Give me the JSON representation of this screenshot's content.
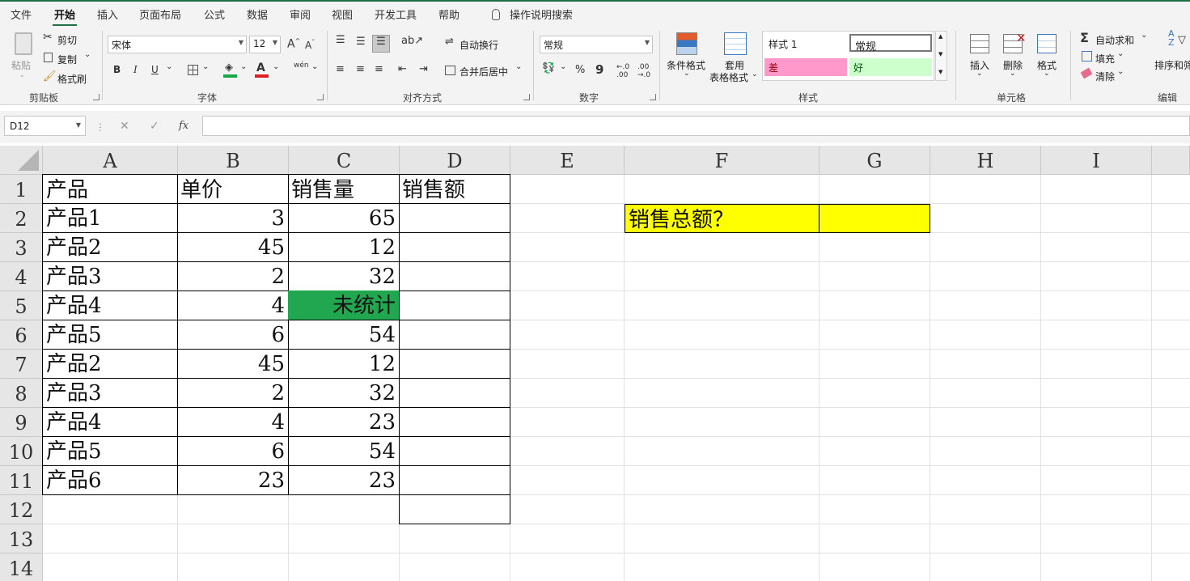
{
  "ribbon_tabs": [
    "文件",
    "开始",
    "插入",
    "页面布局",
    "公式",
    "数据",
    "审阅",
    "视图",
    "开发工具",
    "帮助"
  ],
  "tell_me": "操作说明搜索",
  "clipboard": {
    "paste": "粘贴",
    "cut": "剪切",
    "copy": "复制",
    "format_painter": "格式刷",
    "label": "剪贴板"
  },
  "font": {
    "name": "宋体",
    "size": "12",
    "label": "字体",
    "bold": "B",
    "italic": "I",
    "underline": "U",
    "grow": "A",
    "shrink": "A",
    "phonetic": "wén"
  },
  "alignment": {
    "wrap_text": "自动换行",
    "merge_center": "合并后居中",
    "label": "对齐方式"
  },
  "number": {
    "format": "常规",
    "percent": "%",
    "comma": "9",
    "label": "数字"
  },
  "styles": {
    "conditional_format": "条件格式",
    "table_format_1": "套用",
    "table_format_2": "表格格式",
    "style1": "样式 1",
    "normal": "常规",
    "bad": "差",
    "good": "好",
    "label": "样式"
  },
  "cells_group": {
    "insert": "插入",
    "delete": "删除",
    "format": "格式",
    "label": "单元格"
  },
  "editing": {
    "autosum": "自动求和",
    "fill": "填充",
    "clear": "清除",
    "sort_filter": "排序和筛",
    "label": "编辑"
  },
  "formula_bar": {
    "name_box": "D12",
    "cancel": "✕",
    "enter": "✓",
    "fx": "fx",
    "content": ""
  },
  "columns": [
    "A",
    "B",
    "C",
    "D",
    "E",
    "F",
    "G",
    "H",
    "I"
  ],
  "rows": [
    "1",
    "2",
    "3",
    "4",
    "5",
    "6",
    "7",
    "8",
    "9",
    "10",
    "11",
    "12",
    "13",
    "14"
  ],
  "table": {
    "headers": [
      "产品",
      "单价",
      "销售量",
      "销售额"
    ],
    "rows": [
      [
        "产品1",
        "3",
        "65",
        ""
      ],
      [
        "产品2",
        "45",
        "12",
        ""
      ],
      [
        "产品3",
        "2",
        "32",
        ""
      ],
      [
        "产品4",
        "4",
        "未统计",
        ""
      ],
      [
        "产品5",
        "6",
        "54",
        ""
      ],
      [
        "产品2",
        "45",
        "12",
        ""
      ],
      [
        "产品3",
        "2",
        "32",
        ""
      ],
      [
        "产品4",
        "4",
        "23",
        ""
      ],
      [
        "产品5",
        "6",
        "54",
        ""
      ],
      [
        "产品6",
        "23",
        "23",
        ""
      ]
    ]
  },
  "summary": {
    "label": "销售总额？",
    "value": ""
  },
  "colors": {
    "accent": "#1e7145",
    "highlight_yellow": "#ffff00",
    "unstat_green": "#21a750",
    "bad_fill": "#ff99cc",
    "good_fill": "#ccffcc"
  }
}
